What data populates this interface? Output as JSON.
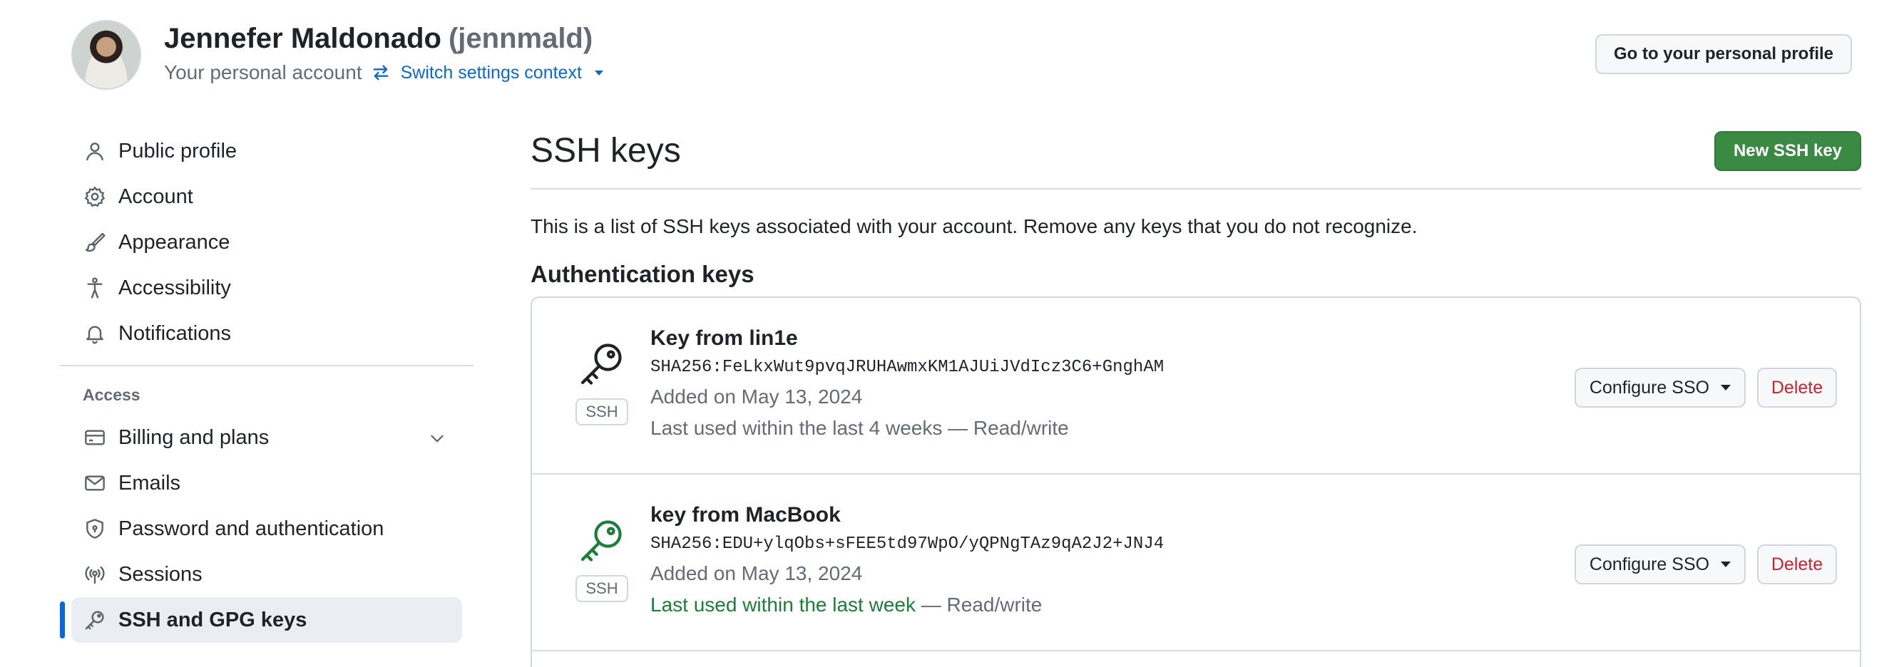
{
  "header": {
    "user_name": "Jennefer Maldonado",
    "user_handle": "(jennmald)",
    "account_label": "Your personal account",
    "switch_context_label": "Switch settings context",
    "profile_button_label": "Go to your personal profile"
  },
  "sidebar": {
    "items_top": [
      {
        "label": "Public profile",
        "icon": "person-icon"
      },
      {
        "label": "Account",
        "icon": "gear-icon"
      },
      {
        "label": "Appearance",
        "icon": "paintbrush-icon"
      },
      {
        "label": "Accessibility",
        "icon": "accessibility-icon"
      },
      {
        "label": "Notifications",
        "icon": "bell-icon"
      }
    ],
    "section_access_label": "Access",
    "items_access": [
      {
        "label": "Billing and plans",
        "icon": "credit-card-icon",
        "expandable": true
      },
      {
        "label": "Emails",
        "icon": "mail-icon"
      },
      {
        "label": "Password and authentication",
        "icon": "shield-lock-icon"
      },
      {
        "label": "Sessions",
        "icon": "broadcast-icon"
      },
      {
        "label": "SSH and GPG keys",
        "icon": "key-icon",
        "active": true
      }
    ]
  },
  "main": {
    "title": "SSH keys",
    "new_key_button": "New SSH key",
    "intro_text": "This is a list of SSH keys associated with your account. Remove any keys that you do not recognize.",
    "auth_heading": "Authentication keys",
    "keys": [
      {
        "title": "Key from lin1e",
        "fingerprint": "SHA256:FeLkxWut9pvqJRUHAwmxKM1AJUiJVdIcz3C6+GnghAM",
        "added": "Added on May 13, 2024",
        "last_used": "Last used within the last 4 weeks",
        "access": " — Read/write",
        "badge": "SSH",
        "icon_color": "#1f2328",
        "configure_label": "Configure SSO",
        "delete_label": "Delete"
      },
      {
        "title": "key from MacBook",
        "fingerprint": "SHA256:EDU+ylqObs+sFEE5td97WpO/yQPNgTAz9qA2J2+JNJ4",
        "added": "Added on May 13, 2024",
        "last_used": "Last used within the last week",
        "access": " — Read/write",
        "badge": "SSH",
        "icon_color": "#1a7f37",
        "configure_label": "Configure SSO",
        "delete_label": "Delete"
      }
    ]
  },
  "colors": {
    "accent_blue": "#0969da",
    "primary_green": "#3a8a44",
    "danger_red": "#cf222e",
    "muted_text": "#636c76"
  }
}
